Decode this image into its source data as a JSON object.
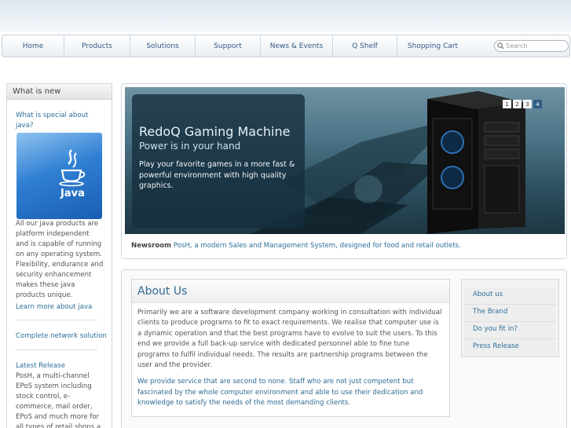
{
  "nav": {
    "items": [
      "Home",
      "Products",
      "Solutions",
      "Support",
      "News & Events",
      "Q Shelf",
      "Shopping Cart"
    ],
    "search_placeholder": "Search"
  },
  "sidebar": {
    "title": "What is new",
    "java_question": "What is special about java?",
    "java_logo_text": "Java",
    "java_body": "All our java products are platform independent and is capable of running on any operating system. Flexibility, endurance and security enhancement makes these java products unique.",
    "java_link": "Learn more about java",
    "network_link": "Complete network solution",
    "latest_title": "Latest Release",
    "latest_body": "PosH, a multi-channel EPoS system including stock control, e-commerce, mail order, EPoS and much more for all types of retail shops a single"
  },
  "hero": {
    "title": "RedoQ Gaming Machine",
    "subtitle": "Power is in your hand",
    "body": "Play your favorite games in a more fast & powerful environment with high quality graphics.",
    "pages": [
      "1",
      "2",
      "3",
      "4"
    ],
    "active_page": "4"
  },
  "newsroom": {
    "label": "Newsroom",
    "link": "PosH, a modern Sales and Management System, designed for food and retail outlets."
  },
  "about": {
    "title": "About Us",
    "para1": "Primarily we are a software development company working in consultation with individual clients to produce programs to fit to exact requirements. We realise that computer use is a dynamic operation and that the best programs have to evolve to suit the users. To this end we provide a full back-up service with dedicated personnel able to fine tune programs to fulfil individual needs. The results are partnership programs between the user and the provider.",
    "para2": "We provide service that are second to none. Staff who are not just competent but fascinated by the whole computer environment and able to use their dedication and knowledge to satisfy the needs of the most demanding clients."
  },
  "side_links": [
    "About us",
    "The Brand",
    "Do you fit in?",
    "Press Release"
  ],
  "colors": {
    "link": "#2d6f99",
    "nav_text": "#335a83",
    "active_page": "#2f5d84"
  }
}
